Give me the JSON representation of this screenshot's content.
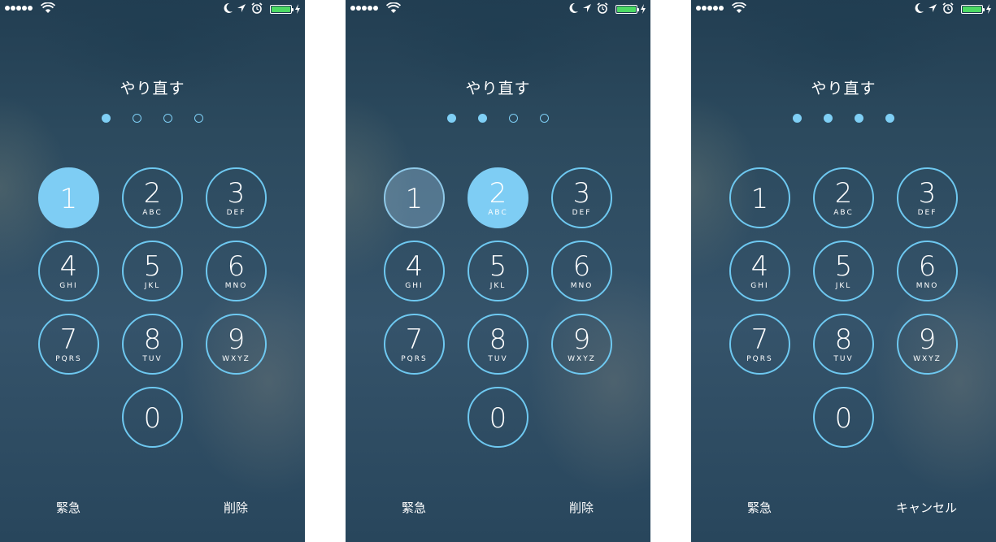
{
  "colors": {
    "accent": "#7fcff5",
    "battery": "#4cd964",
    "text": "#ffffff"
  },
  "icons": [
    "signal-dots",
    "wifi-icon",
    "moon-icon",
    "location-arrow-icon",
    "alarm-clock-icon",
    "battery-icon",
    "charging-bolt-icon"
  ],
  "screens": [
    {
      "title": "やり直す",
      "passcode_filled": 1,
      "passcode_total": 4,
      "pressed_key": "1",
      "keys": [
        {
          "num": "1",
          "letters": ""
        },
        {
          "num": "2",
          "letters": "ABC"
        },
        {
          "num": "3",
          "letters": "DEF"
        },
        {
          "num": "4",
          "letters": "GHI"
        },
        {
          "num": "5",
          "letters": "JKL"
        },
        {
          "num": "6",
          "letters": "MNO"
        },
        {
          "num": "7",
          "letters": "PQRS"
        },
        {
          "num": "8",
          "letters": "TUV"
        },
        {
          "num": "9",
          "letters": "WXYZ"
        },
        {
          "num": "0",
          "letters": ""
        }
      ],
      "left_action": "緊急",
      "right_action": "削除"
    },
    {
      "title": "やり直す",
      "passcode_filled": 2,
      "passcode_total": 4,
      "pressed_key": "2",
      "fading_key": "1",
      "keys": [
        {
          "num": "1",
          "letters": ""
        },
        {
          "num": "2",
          "letters": "ABC"
        },
        {
          "num": "3",
          "letters": "DEF"
        },
        {
          "num": "4",
          "letters": "GHI"
        },
        {
          "num": "5",
          "letters": "JKL"
        },
        {
          "num": "6",
          "letters": "MNO"
        },
        {
          "num": "7",
          "letters": "PQRS"
        },
        {
          "num": "8",
          "letters": "TUV"
        },
        {
          "num": "9",
          "letters": "WXYZ"
        },
        {
          "num": "0",
          "letters": ""
        }
      ],
      "left_action": "緊急",
      "right_action": "削除"
    },
    {
      "title": "やり直す",
      "passcode_filled": 4,
      "passcode_total": 4,
      "keys": [
        {
          "num": "1",
          "letters": ""
        },
        {
          "num": "2",
          "letters": "ABC"
        },
        {
          "num": "3",
          "letters": "DEF"
        },
        {
          "num": "4",
          "letters": "GHI"
        },
        {
          "num": "5",
          "letters": "JKL"
        },
        {
          "num": "6",
          "letters": "MNO"
        },
        {
          "num": "7",
          "letters": "PQRS"
        },
        {
          "num": "8",
          "letters": "TUV"
        },
        {
          "num": "9",
          "letters": "WXYZ"
        },
        {
          "num": "0",
          "letters": ""
        }
      ],
      "left_action": "緊急",
      "right_action": "キャンセル"
    }
  ]
}
